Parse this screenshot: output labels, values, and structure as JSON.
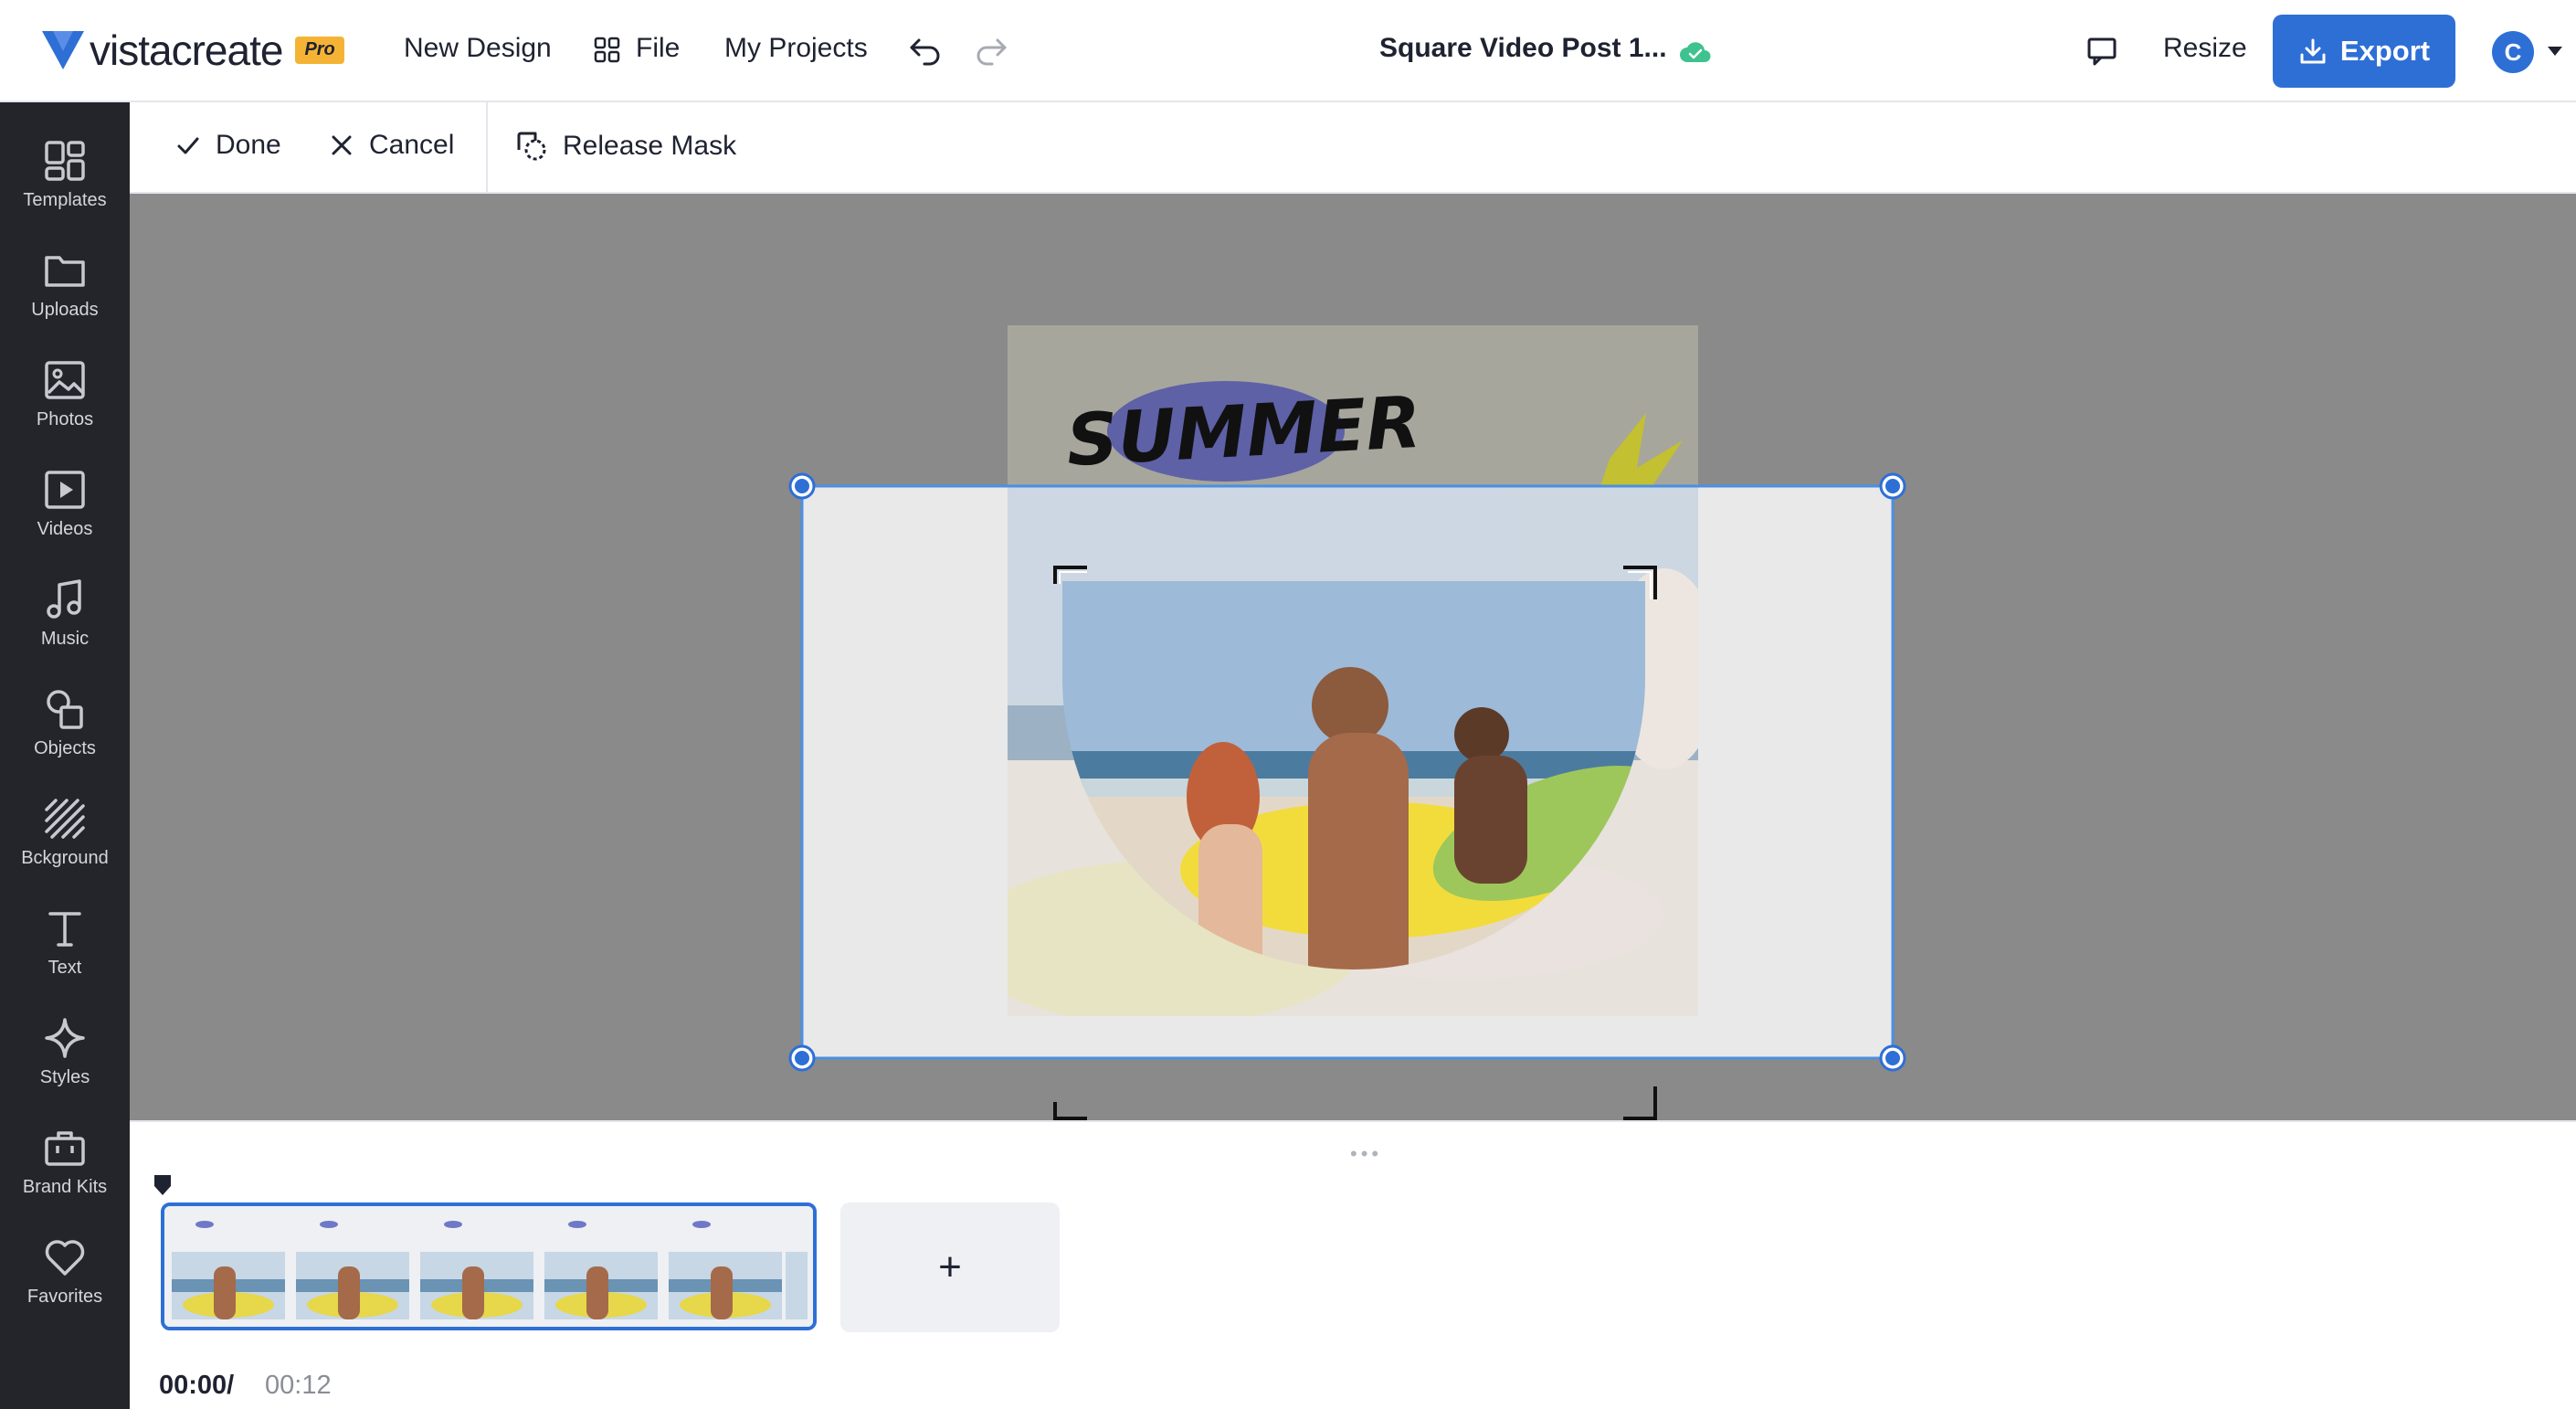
{
  "header": {
    "logo_text": "vistacreate",
    "pro_badge": "Pro",
    "new_design": "New Design",
    "file": "File",
    "my_projects": "My Projects",
    "doc_title": "Square Video Post 1...",
    "resize": "Resize",
    "export": "Export",
    "avatar_initial": "C"
  },
  "sidebar": {
    "items": [
      {
        "label": "Templates",
        "icon": "templates-icon"
      },
      {
        "label": "Uploads",
        "icon": "folder-icon"
      },
      {
        "label": "Photos",
        "icon": "image-icon"
      },
      {
        "label": "Videos",
        "icon": "video-icon"
      },
      {
        "label": "Music",
        "icon": "music-icon"
      },
      {
        "label": "Objects",
        "icon": "shapes-icon"
      },
      {
        "label": "Bckground",
        "icon": "background-icon"
      },
      {
        "label": "Text",
        "icon": "text-icon"
      },
      {
        "label": "Styles",
        "icon": "sparkle-icon"
      },
      {
        "label": "Brand Kits",
        "icon": "briefcase-icon"
      },
      {
        "label": "Favorites",
        "icon": "heart-icon"
      }
    ]
  },
  "mask_toolbar": {
    "done": "Done",
    "cancel": "Cancel",
    "release_mask": "Release Mask"
  },
  "canvas": {
    "design_text": "SUMMER",
    "colors": {
      "accent": "#2e6fd6",
      "canvas_bg": "#8a8a8a",
      "sidebar_bg": "#24252b"
    }
  },
  "timeline": {
    "add_label": "+",
    "current_time": "00:00/",
    "total_time": "00:12"
  }
}
